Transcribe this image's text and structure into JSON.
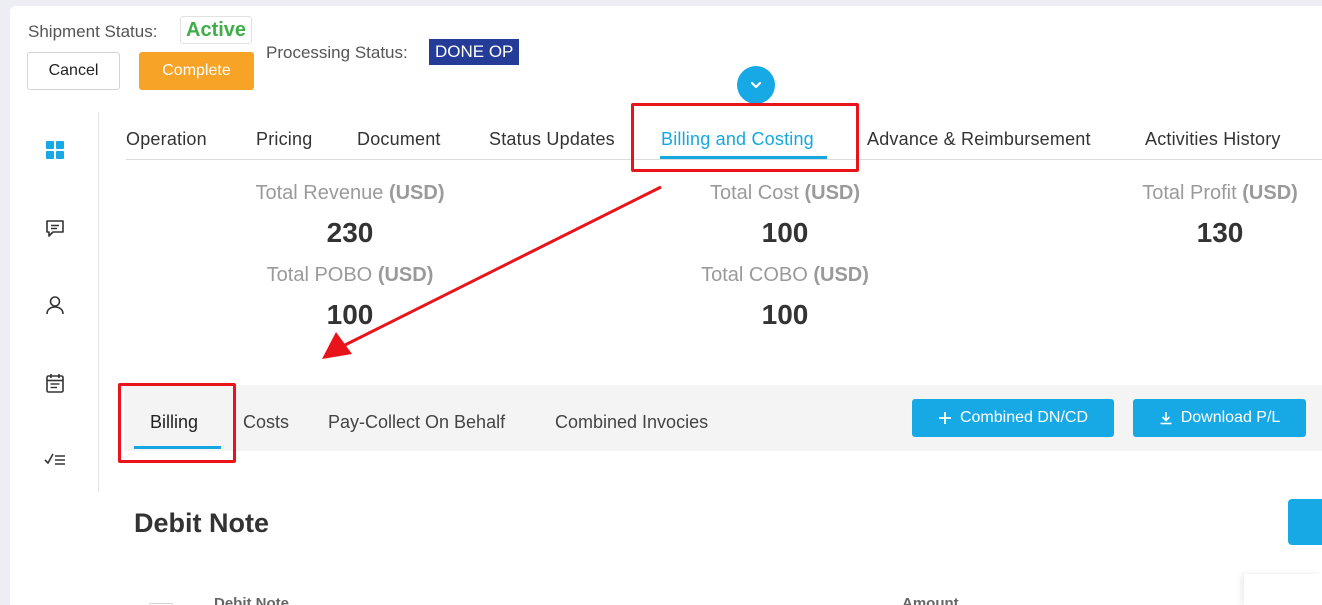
{
  "header": {
    "shipment_status_label": "Shipment Status:",
    "shipment_status_value": "Active",
    "processing_status_label": "Processing Status:",
    "processing_status_value": "DONE OP",
    "cancel_label": "Cancel",
    "complete_label": "Complete"
  },
  "tabs": [
    {
      "label": "Operation"
    },
    {
      "label": "Pricing"
    },
    {
      "label": "Document"
    },
    {
      "label": "Status Updates"
    },
    {
      "label": "Billing and Costing"
    },
    {
      "label": "Advance & Reimbursement"
    },
    {
      "label": "Activities History"
    }
  ],
  "summary": {
    "currency": "(USD)",
    "total_revenue_label": "Total Revenue",
    "total_revenue_value": "230",
    "total_cost_label": "Total Cost",
    "total_cost_value": "100",
    "total_profit_label": "Total Profit",
    "total_profit_value": "130",
    "total_pobo_label": "Total POBO",
    "total_pobo_value": "100",
    "total_cobo_label": "Total COBO",
    "total_cobo_value": "100"
  },
  "subtabs": [
    {
      "label": "Billing"
    },
    {
      "label": "Costs"
    },
    {
      "label": "Pay-Collect On Behalf"
    },
    {
      "label": "Combined Invocies"
    }
  ],
  "actions": {
    "combined_label": "Combined DN/CD",
    "download_label": "Download P/L"
  },
  "section": {
    "title": "Debit Note",
    "col_debit_note": "Debit Note",
    "col_amount": "Amount"
  },
  "colors": {
    "accent": "#17a9e6",
    "complete": "#f7a325",
    "active_green": "#3fae49",
    "done_badge": "#243c97",
    "annotation_red": "#e8141a"
  }
}
